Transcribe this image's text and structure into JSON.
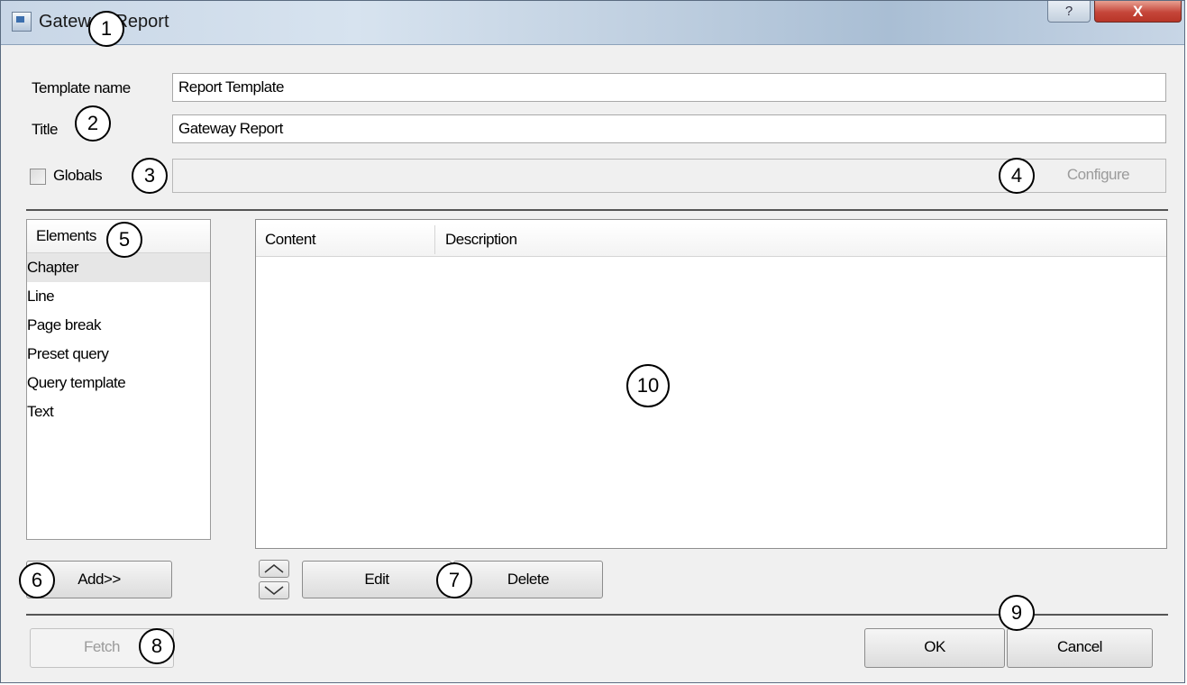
{
  "window": {
    "title": "Gateway Report",
    "help_label": "?",
    "close_label": "X"
  },
  "form": {
    "template_name_label": "Template name",
    "template_name_value": "Report Template",
    "title_label": "Title",
    "title_value": "Gateway Report",
    "globals_label": "Globals",
    "globals_checked": false,
    "configure_label": "Configure"
  },
  "elements": {
    "header": "Elements",
    "items": [
      "Chapter",
      "Line",
      "Page break",
      "Preset query",
      "Query template",
      "Text"
    ],
    "selected": "Chapter"
  },
  "content_grid": {
    "columns": [
      "Content",
      "Description"
    ]
  },
  "buttons": {
    "add": "Add>>",
    "edit": "Edit",
    "delete": "Delete",
    "fetch": "Fetch",
    "ok": "OK",
    "cancel": "Cancel"
  },
  "callouts": [
    "1",
    "2",
    "3",
    "4",
    "5",
    "6",
    "7",
    "8",
    "9",
    "10"
  ]
}
